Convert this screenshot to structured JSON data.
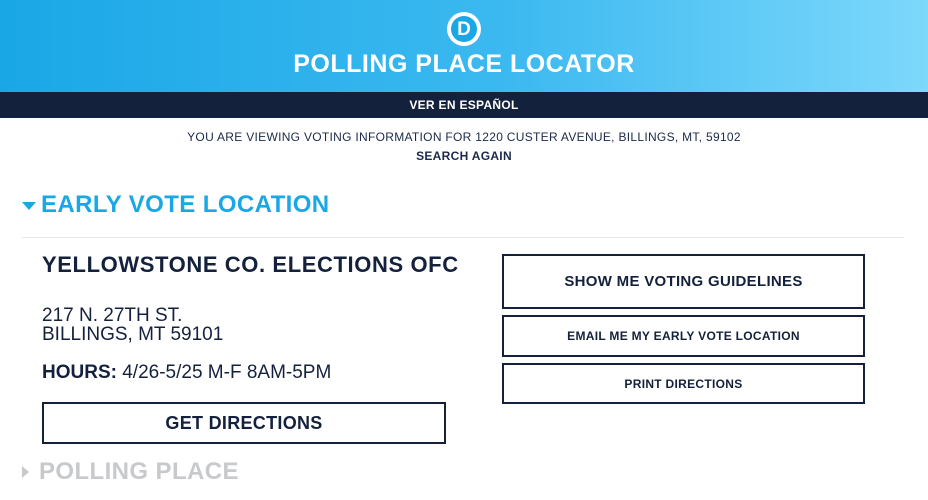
{
  "header": {
    "logo_letter": "D",
    "logo_icon": "democratic-party-logo-icon",
    "title": "POLLING PLACE LOCATOR"
  },
  "language_bar": {
    "label": "VER EN ESPAÑOL"
  },
  "viewing": {
    "text": "YOU ARE VIEWING VOTING INFORMATION FOR 1220 CUSTER AVENUE, BILLINGS, MT, 59102",
    "search_again": "SEARCH AGAIN"
  },
  "early_vote": {
    "section_title": "EARLY VOTE LOCATION",
    "expanded": true,
    "location_name": "YELLOWSTONE CO. ELECTIONS OFC",
    "address_line1": "217 N. 27TH ST.",
    "address_line2": "BILLINGS, MT 59101",
    "hours_label": "HOURS:",
    "hours_value": "4/26-5/25 M-F 8AM-5PM",
    "get_directions_label": "GET DIRECTIONS",
    "show_guidelines_label": "SHOW ME VOTING GUIDELINES",
    "email_label": "EMAIL ME MY EARLY VOTE LOCATION",
    "print_label": "PRINT DIRECTIONS"
  },
  "polling_place": {
    "section_title": "POLLING PLACE",
    "expanded": false
  },
  "colors": {
    "accent": "#1aa7e6",
    "navy": "#14213d",
    "muted": "#c7c9cc"
  }
}
